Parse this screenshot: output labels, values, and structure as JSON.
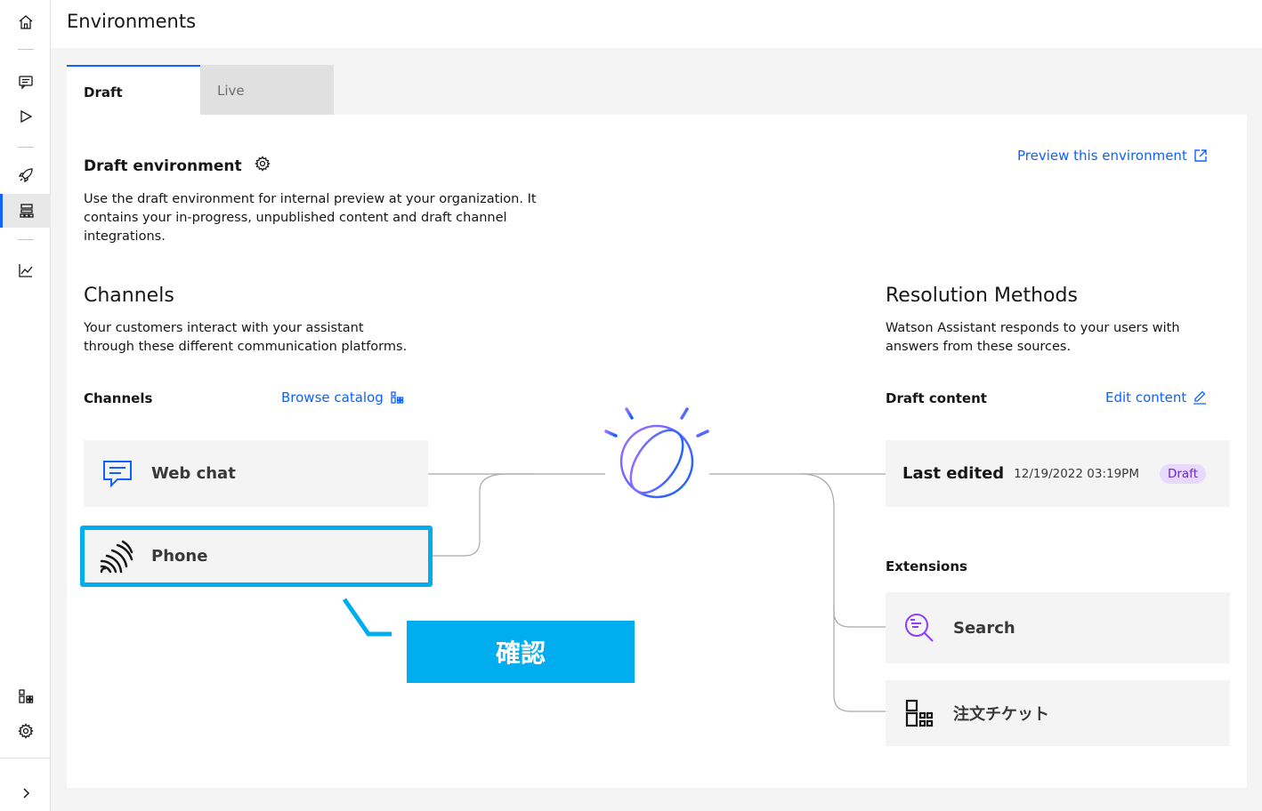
{
  "header": {
    "title": "Environments"
  },
  "tabs": [
    {
      "label": "Draft",
      "active": true
    },
    {
      "label": "Live",
      "active": false
    }
  ],
  "env": {
    "title": "Draft environment",
    "description_lines": [
      "Use the draft environment for internal preview at your organization. It",
      "contains your in-progress, unpublished content and draft channel",
      "integrations."
    ],
    "preview_link": "Preview this environment"
  },
  "channels": {
    "title": "Channels",
    "description_lines": [
      "Your customers interact with your assistant",
      "through these different communication platforms."
    ],
    "subhead": "Channels",
    "browse_link": "Browse catalog",
    "items": [
      {
        "label": "Web chat",
        "icon": "chat-icon"
      },
      {
        "label": "Phone",
        "icon": "phone-signal-icon"
      }
    ]
  },
  "resolution": {
    "title": "Resolution Methods",
    "description_lines": [
      "Watson Assistant responds to your users with",
      "answers from these sources."
    ],
    "draft_content": {
      "subhead": "Draft content",
      "edit_link": "Edit content",
      "last_edited_label": "Last edited",
      "timestamp": "12/19/2022 03:19PM",
      "badge": "Draft"
    },
    "extensions": {
      "subhead": "Extensions",
      "items": [
        {
          "label": "Search",
          "icon": "search-icon"
        },
        {
          "label": "注文チケット",
          "icon": "apps-icon"
        }
      ]
    }
  },
  "annotation": {
    "callout_text": "確認"
  },
  "colors": {
    "accent": "#0f62fe",
    "callout": "#00aeef",
    "badge_bg": "#e8daff",
    "badge_fg": "#6929c4"
  }
}
